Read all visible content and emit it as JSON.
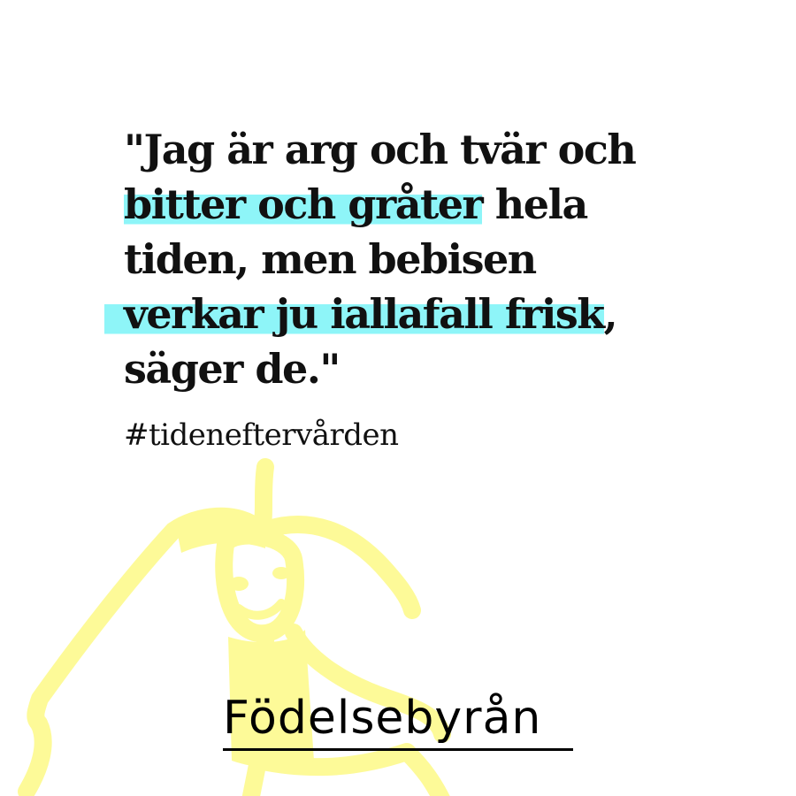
{
  "quote": {
    "lines": [
      {
        "text": "\"Jag är arg och tvär och"
      },
      {
        "highlight": "bitter och gråter",
        "rest": " hela"
      },
      {
        "text": "tiden, men bebisen"
      },
      {
        "highlight": "verkar ju iallafall frisk",
        "rest": ","
      },
      {
        "text": "säger de.\""
      }
    ]
  },
  "hashtag": "#tideneftervården",
  "logo": "Födelsebyrån",
  "colors": {
    "background": "#ffffff",
    "text": "#111111",
    "highlight": "#8ef5f8",
    "doodle": "#fdfa98"
  },
  "illustration": "yellow-child-doodle"
}
